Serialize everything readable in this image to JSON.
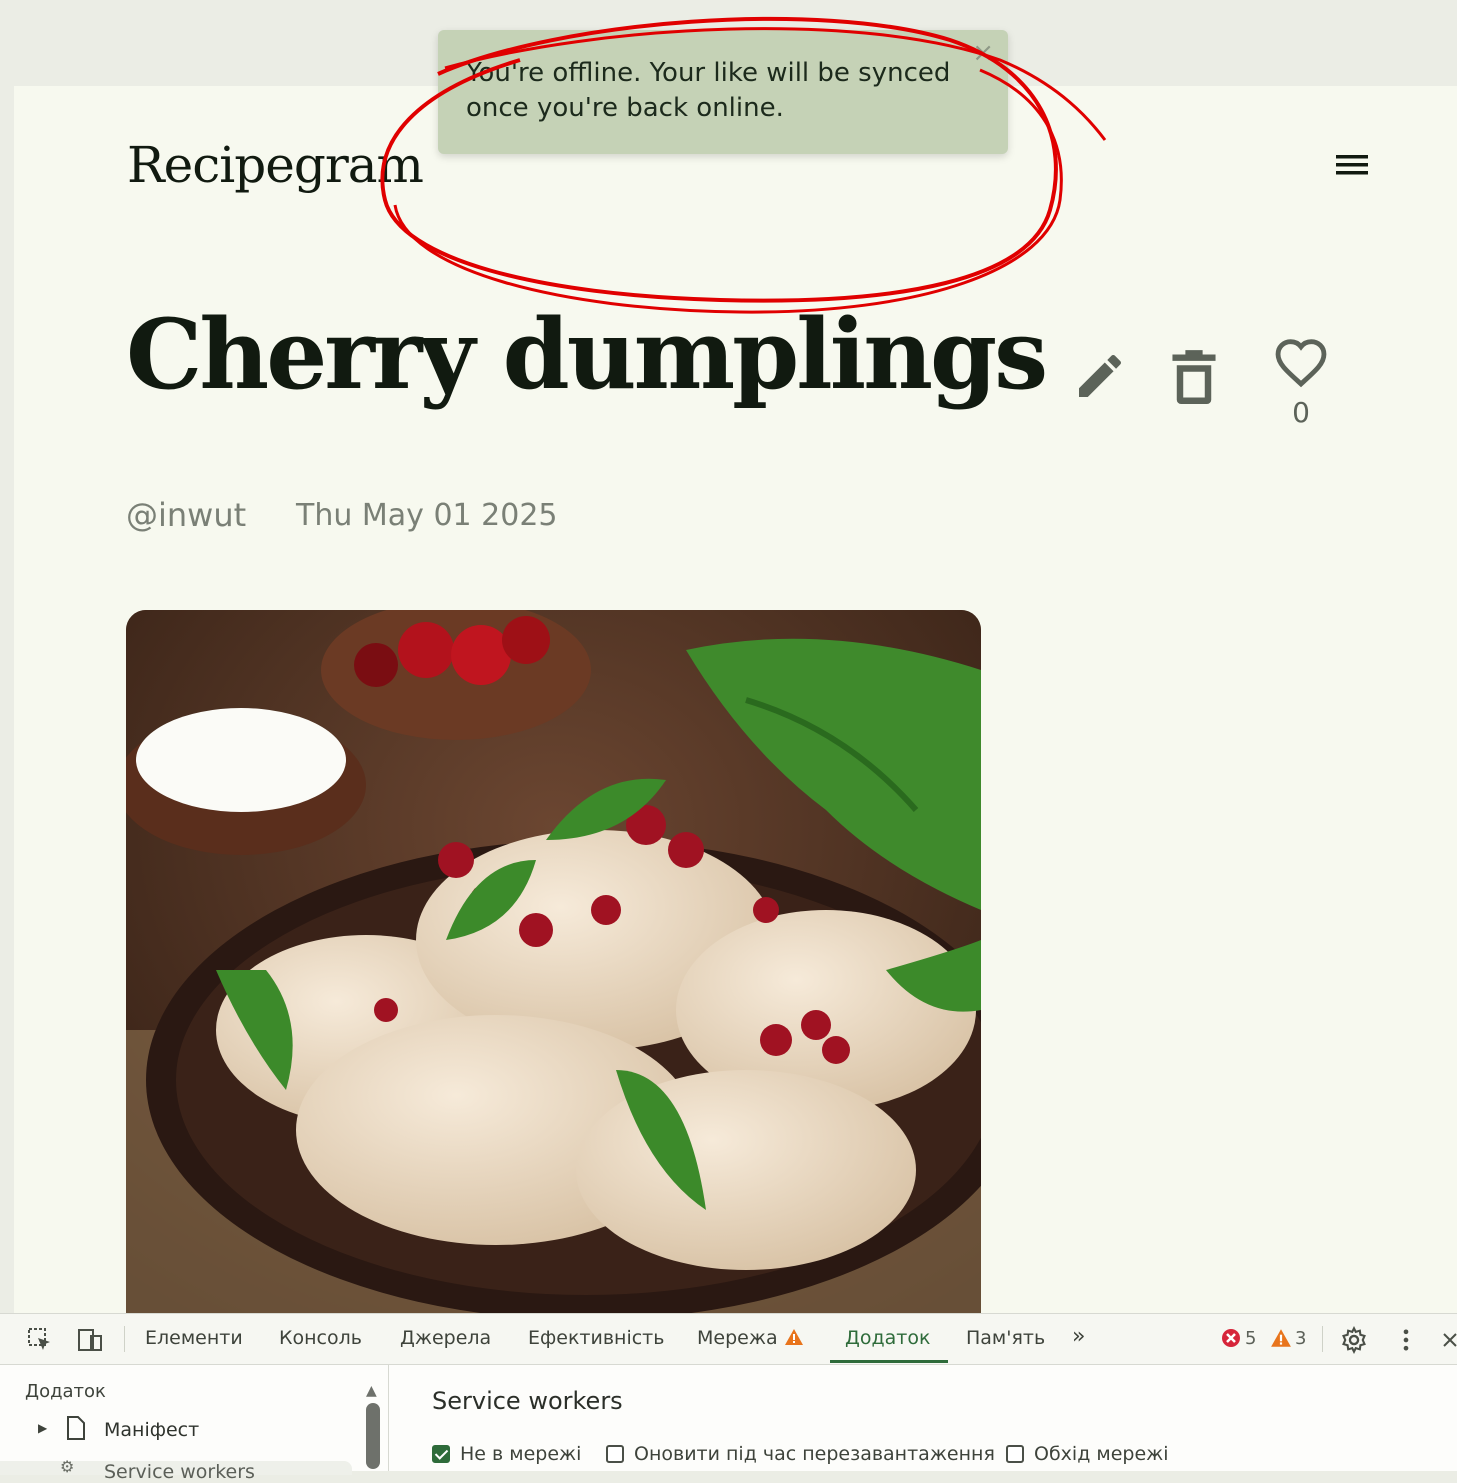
{
  "app": {
    "logo": "Recipegram",
    "menu_icon": "menu-icon"
  },
  "toast": {
    "message": "You're offline. Your like will be synced once you're back online.",
    "close": "×"
  },
  "recipe": {
    "title": "Cherry dumplings",
    "author": "@inwut",
    "date": "Thu May 01 2025",
    "likes": "0",
    "icons": [
      "edit-icon",
      "delete-icon",
      "heart-icon"
    ]
  },
  "devtools": {
    "tabs": [
      "Елементи",
      "Консоль",
      "Джерела",
      "Ефективність",
      "Мережа",
      "Додаток",
      "Пам'ять"
    ],
    "active_tab": "Додаток",
    "more": "»",
    "errors": "5",
    "warnings": "3",
    "sidebar": {
      "heading": "Додаток",
      "items": [
        "Маніфест",
        "Service workers"
      ]
    },
    "main": {
      "title": "Service workers",
      "checkboxes": [
        {
          "label": "Не в мережі",
          "checked": true
        },
        {
          "label": "Оновити під час перезавантаження",
          "checked": false
        },
        {
          "label": "Обхід мережі",
          "checked": false
        }
      ]
    }
  },
  "colors": {
    "page_bg": "#f7f9ef",
    "toast_bg": "#c5d2b6",
    "accent": "#2e6b3a",
    "annotation": "#e00000"
  }
}
